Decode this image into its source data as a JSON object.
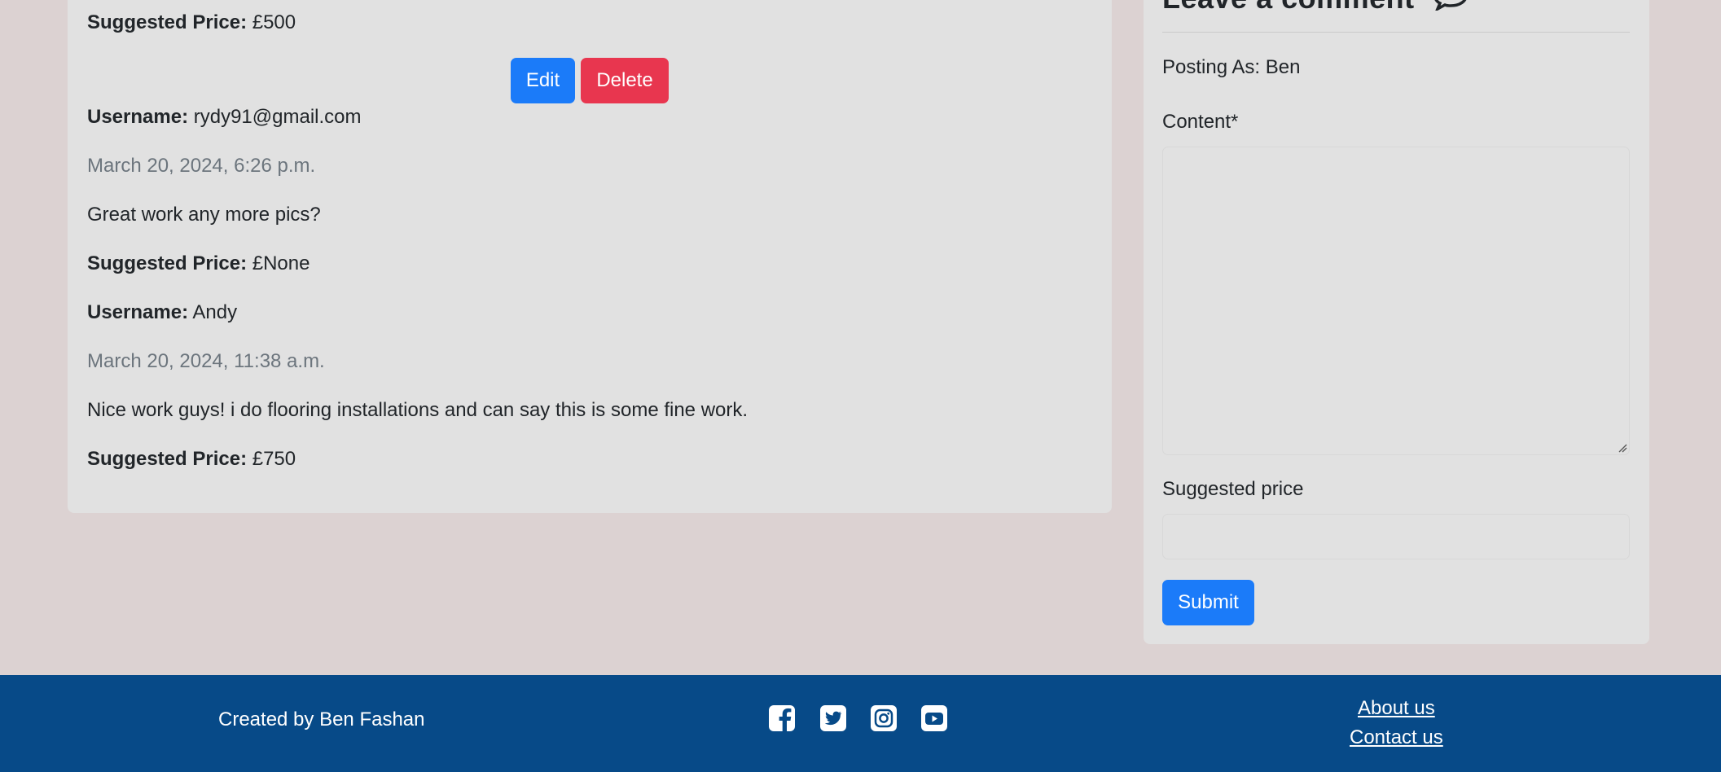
{
  "comments": [
    {
      "price_label": "Suggested Price:",
      "price_value": " £500",
      "edit_label": "Edit",
      "delete_label": "Delete"
    },
    {
      "username_label": "Username:",
      "username": " rydy91@gmail.com",
      "date": "March 20, 2024, 6:26 p.m.",
      "content": "Great work any more pics?",
      "price_label": "Suggested Price:",
      "price_value": " £None"
    },
    {
      "username_label": "Username:",
      "username": " Andy",
      "date": "March 20, 2024, 11:38 a.m.",
      "content": "Nice work guys! i do flooring installations and can say this is some fine work.",
      "price_label": "Suggested Price:",
      "price_value": " £750"
    }
  ],
  "comment_form": {
    "title": "Leave a comment",
    "title_icon": "chat-bubble-icon",
    "posting_as": "Posting As: Ben",
    "content_label": "Content*",
    "content_value": "",
    "price_label": "Suggested price",
    "price_value": "",
    "submit_label": "Submit"
  },
  "footer": {
    "credit": "Created by Ben Fashan",
    "social_icons": [
      "facebook-icon",
      "twitter-icon",
      "instagram-icon",
      "youtube-icon"
    ],
    "links": [
      "About us",
      "Contact us"
    ]
  },
  "colors": {
    "page_background": "#dcd2d2",
    "card_background": "#e1e1e1",
    "primary": "#1b7bf9",
    "danger": "#e8364f",
    "footer_background": "#074a88"
  }
}
